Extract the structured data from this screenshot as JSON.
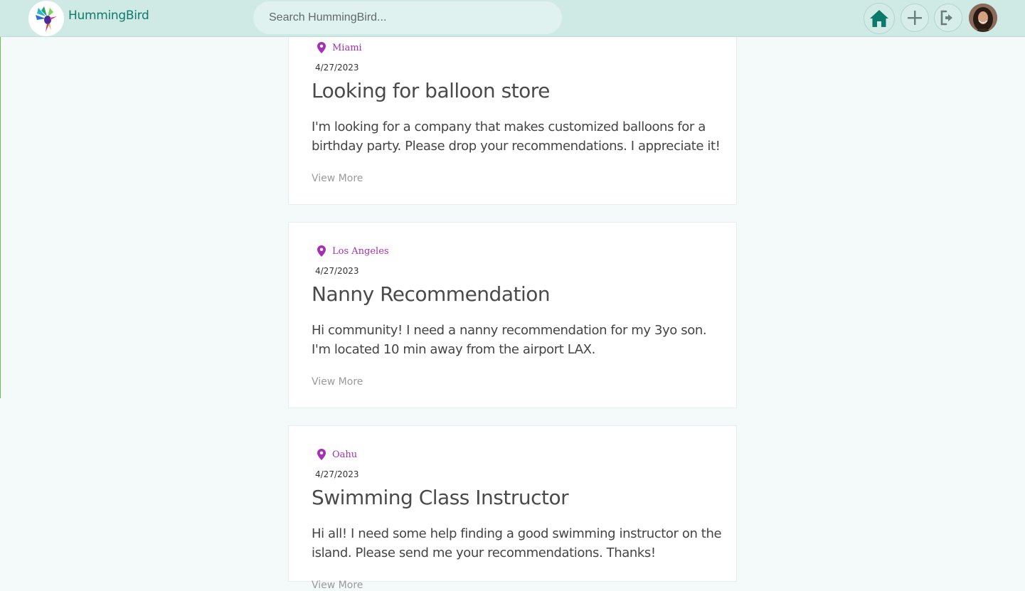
{
  "app": {
    "name": "HummingBird"
  },
  "search": {
    "placeholder": "Search HummingBird..."
  },
  "nav": {
    "icons": [
      "home-icon",
      "plus-icon",
      "logout-icon",
      "avatar"
    ]
  },
  "colors": {
    "navbar": "#cfe9e4",
    "accent": "#0f7a6c",
    "location": "#a62fb6",
    "background": "#f4fafa"
  },
  "posts": [
    {
      "location": "Miami",
      "date": "4/27/2023",
      "title": "Looking for balloon store",
      "body": "I'm looking for a company that makes customized balloons for a birthday party. Please drop your recommendations. I appreciate it!",
      "view_more": "View More"
    },
    {
      "location": "Los Angeles",
      "date": "4/27/2023",
      "title": "Nanny Recommendation",
      "body": "Hi community! I need a nanny recommendation for my 3yo son. I'm located 10 min away from the airport LAX.",
      "view_more": "View More"
    },
    {
      "location": "Oahu",
      "date": "4/27/2023",
      "title": "Swimming Class Instructor",
      "body": "Hi all! I need some help finding a good swimming instructor on the island. Please send me your recommendations. Thanks!",
      "view_more": "View More"
    }
  ]
}
